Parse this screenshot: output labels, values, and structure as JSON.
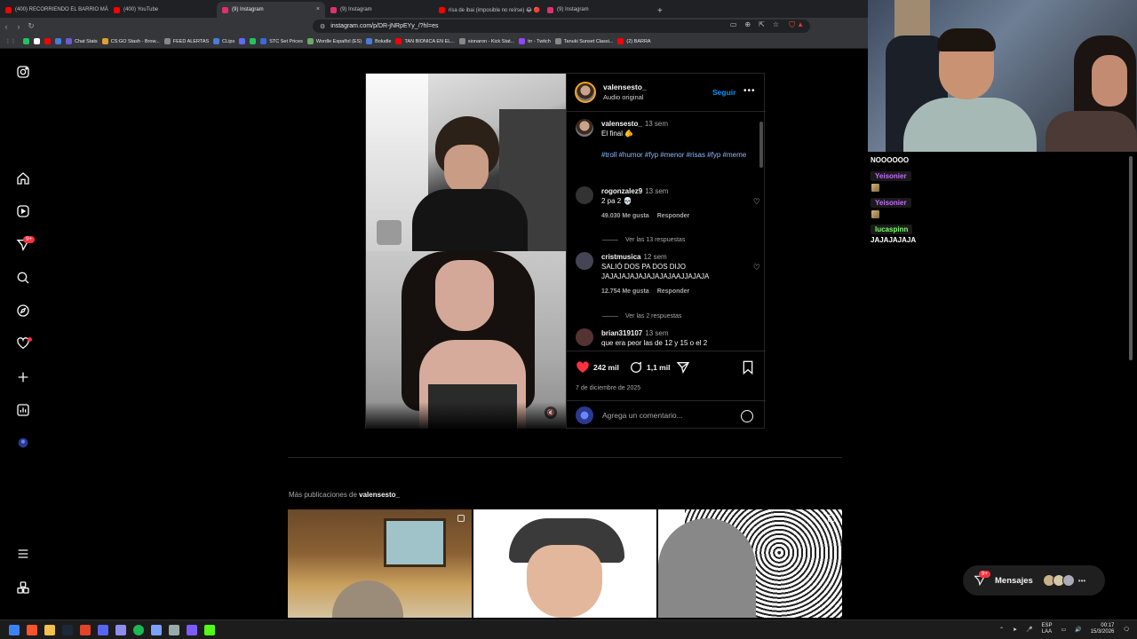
{
  "browser": {
    "tabs": [
      {
        "label": "(400) RECORRIENDO EL BARRIO MÁ",
        "color": "#ff0000",
        "active": false
      },
      {
        "label": "(400) YouTube",
        "color": "#ff0000",
        "active": false
      },
      {
        "label": "(9) Instagram",
        "color": "#e1306c",
        "active": true
      },
      {
        "label": "(9) Instagram",
        "color": "#e1306c",
        "active": false
      },
      {
        "label": "risa de ibai (imposible no reírse) 😂 🔴",
        "color": "#ff0000",
        "active": false
      },
      {
        "label": "(9) Instagram",
        "color": "#e1306c",
        "active": false
      }
    ],
    "tab_close": "×",
    "new_tab": "+",
    "url": "instagram.com/p/DR-jNRpEYy_/?hl=es",
    "bookmarks": [
      {
        "label": "",
        "color": "#21c55d"
      },
      {
        "label": "",
        "color": "#ffffff"
      },
      {
        "label": "",
        "color": "#ff0000"
      },
      {
        "label": "",
        "color": "#4a7bd9"
      },
      {
        "label": "Chat Stats",
        "color": "#6b5bd6"
      },
      {
        "label": "CS:GO Stash - Brow...",
        "color": "#e0a030"
      },
      {
        "label": "FEED ALERTAS",
        "color": "#888888"
      },
      {
        "label": "CLips",
        "color": "#4a7bd9"
      },
      {
        "label": "",
        "color": "#5b6bff"
      },
      {
        "label": "",
        "color": "#21c55d"
      },
      {
        "label": "STC Set Prices",
        "color": "#3a6ad9"
      },
      {
        "label": "Wordle Español (ES)",
        "color": "#6aaa64"
      },
      {
        "label": "Boludle",
        "color": "#4a7bd9"
      },
      {
        "label": "TAN BIONICA EN EL...",
        "color": "#ff0000"
      },
      {
        "label": "sionaron - Kick Stat...",
        "color": "#888888"
      },
      {
        "label": "trr - Twitch",
        "color": "#9146ff"
      },
      {
        "label": "Tanuki Sunset Classi...",
        "color": "#888888"
      },
      {
        "label": "(2) BARRA",
        "color": "#ff0000"
      }
    ]
  },
  "instagram": {
    "nav_badge": "9+",
    "post": {
      "username": "valensesto_",
      "subtitle": "Audio original",
      "follow": "Seguir",
      "more": "•••",
      "caption": {
        "username": "valensesto_",
        "time": "13 sem",
        "text": "El final 🫵",
        "hashtags": "#troll #humor #fyp #menor #risas #fyp #meme"
      },
      "comments": [
        {
          "username": "rogonzalez9",
          "time": "13 sem",
          "text": "2 pa 2 💀",
          "likes": "49.030 Me gusta",
          "reply": "Responder",
          "view_replies": "Ver las 13 respuestas"
        },
        {
          "username": "cristmusica",
          "time": "12 sem",
          "text": "SALIÓ DOS PA DOS DIJO JAJAJAJAJAJAJAJAJAAJJAJAJA",
          "likes": "12.754 Me gusta",
          "reply": "Responder",
          "view_replies": "Ver las 2 respuestas"
        },
        {
          "username": "brian319107",
          "time": "13 sem",
          "text": "que era peor las de 12 y 15 o el 2"
        }
      ],
      "likes_count": "242 mil",
      "comments_count": "1,1 mil",
      "date": "7 de diciembre de 2025",
      "add_comment_placeholder": "Agrega un comentario...",
      "speaker_icon": "🔇"
    },
    "more_posts_prefix": "Más publicaciones de ",
    "more_posts_user": "valensesto_",
    "messages": {
      "label": "Mensajes",
      "badge": "9+",
      "more": "•••"
    }
  },
  "stream_chat": [
    {
      "type": "text",
      "text": "NOOOOOO"
    },
    {
      "type": "user",
      "name": "Yeisonier",
      "color": "purple"
    },
    {
      "type": "user",
      "name": "Yeisonier",
      "color": "purple"
    },
    {
      "type": "user",
      "name": "lucaspinn",
      "color": "green"
    },
    {
      "type": "text",
      "text": "JAJAJAJAJA"
    }
  ],
  "taskbar": {
    "lang_top": "ESP",
    "lang_bottom": "LAA",
    "time": "00:17",
    "date": "15/3/2026"
  },
  "colors": {
    "accent": "#0095f6",
    "like": "#ff3040",
    "background": "#000000"
  }
}
